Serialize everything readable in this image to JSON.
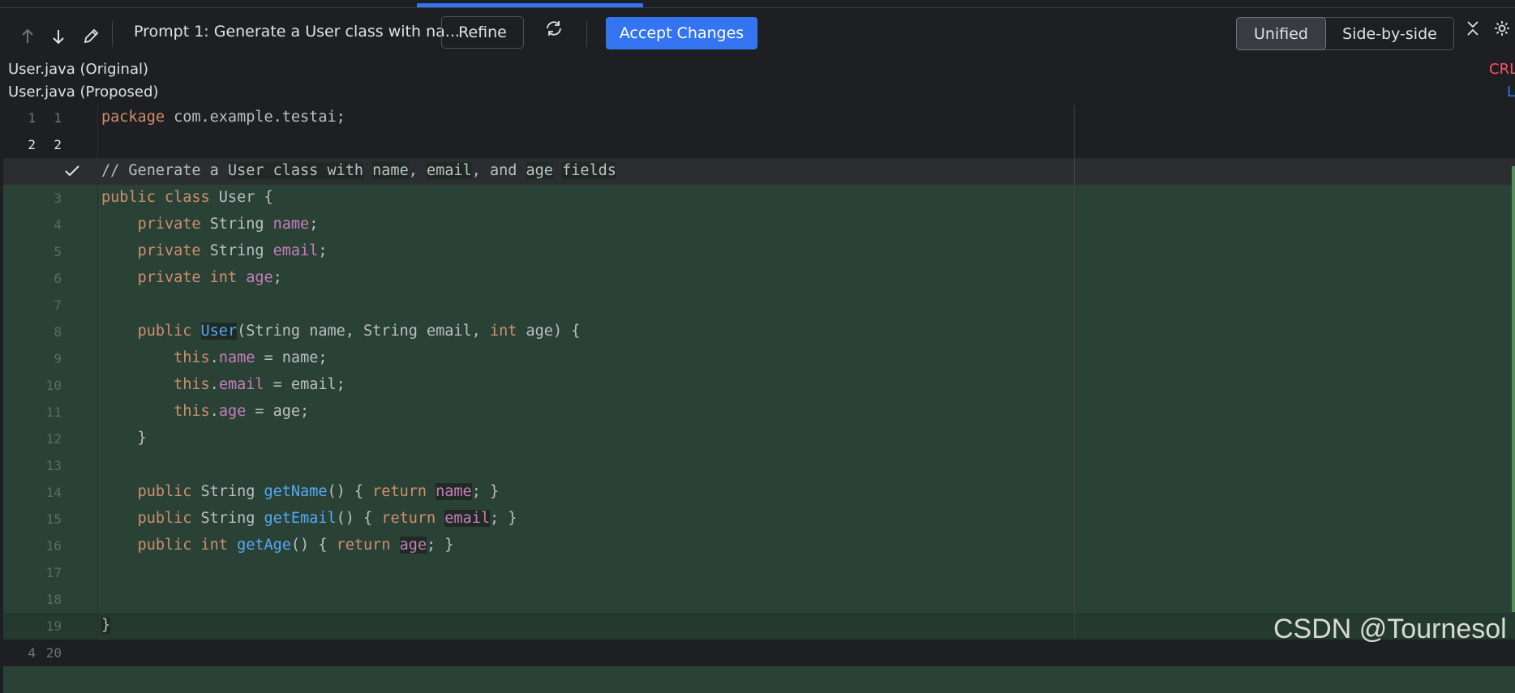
{
  "toolbar": {
    "prompt_title": "Prompt 1: Generate a User class with na...",
    "refine_label": "Refine",
    "accept_label": "Accept Changes",
    "view_modes": [
      "Unified",
      "Side-by-side"
    ],
    "active_view": "Unified",
    "icons": [
      "arrow-up-icon",
      "arrow-down-icon",
      "pencil-icon",
      "sync-icon",
      "collapse-icon",
      "gear-icon"
    ]
  },
  "files": {
    "original_label": "User.java (Original)",
    "proposed_label": "User.java (Proposed)",
    "original_encoding": "CRL",
    "proposed_encoding": "L"
  },
  "diff": {
    "lines": [
      {
        "left": "1",
        "right": "1",
        "text": "package com.example.testai;"
      },
      {
        "left": "2",
        "right": "2",
        "text": ""
      },
      {
        "left": "",
        "right": "",
        "text": "// Generate a User class with name, email, and age fields"
      },
      {
        "left": "",
        "right": "3",
        "text": "public class User {"
      },
      {
        "left": "",
        "right": "4",
        "text": "    private String name;"
      },
      {
        "left": "",
        "right": "5",
        "text": "    private String email;"
      },
      {
        "left": "",
        "right": "6",
        "text": "    private int age;"
      },
      {
        "left": "",
        "right": "7",
        "text": ""
      },
      {
        "left": "",
        "right": "8",
        "text": "    public User(String name, String email, int age) {"
      },
      {
        "left": "",
        "right": "9",
        "text": "        this.name = name;"
      },
      {
        "left": "",
        "right": "10",
        "text": "        this.email = email;"
      },
      {
        "left": "",
        "right": "11",
        "text": "        this.age = age;"
      },
      {
        "left": "",
        "right": "12",
        "text": "    }"
      },
      {
        "left": "",
        "right": "13",
        "text": ""
      },
      {
        "left": "",
        "right": "14",
        "text": "    public String getName() { return name; }"
      },
      {
        "left": "",
        "right": "15",
        "text": "    public String getEmail() { return email; }"
      },
      {
        "left": "",
        "right": "16",
        "text": "    public int getAge() { return age; }"
      },
      {
        "left": "",
        "right": "17",
        "text": ""
      },
      {
        "left": "",
        "right": "18",
        "text": ""
      },
      {
        "left": "",
        "right": "19",
        "text": "}"
      },
      {
        "left": "4",
        "right": "20",
        "text": ""
      }
    ]
  },
  "watermark": "CSDN @Tournesol",
  "colors": {
    "accent": "#3574f0",
    "added_background": "#2a4236",
    "keyword": "#cf8e6d",
    "field": "#c77dbb",
    "function": "#56a8f5",
    "comment": "#7a7e85"
  }
}
